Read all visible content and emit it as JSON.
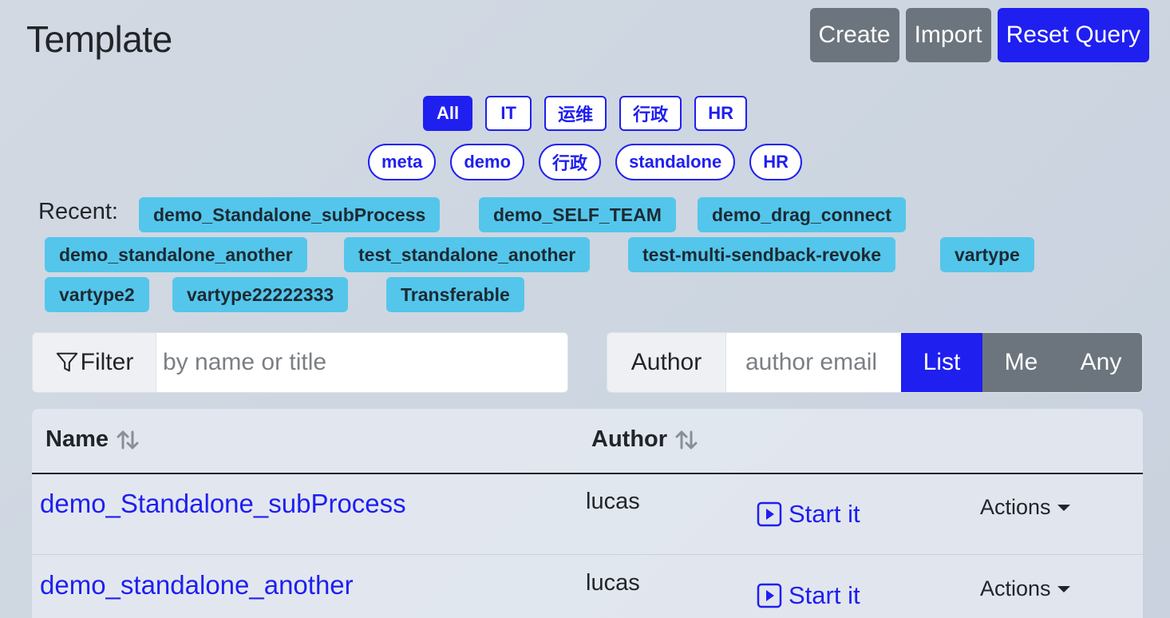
{
  "page": {
    "title": "Template"
  },
  "header_buttons": {
    "create": "Create",
    "import": "Import",
    "reset": "Reset Query"
  },
  "categories": [
    {
      "label": "All",
      "active": true
    },
    {
      "label": "IT",
      "active": false
    },
    {
      "label": "运维",
      "active": false
    },
    {
      "label": "行政",
      "active": false
    },
    {
      "label": "HR",
      "active": false
    }
  ],
  "tags": [
    "meta",
    "demo",
    "行政",
    "standalone",
    "HR"
  ],
  "recent": {
    "label": "Recent:",
    "items": [
      "demo_Standalone_subProcess",
      "demo_SELF_TEAM",
      "demo_drag_connect",
      "demo_standalone_another",
      "test_standalone_another",
      "test-multi-sendback-revoke",
      "vartype",
      "vartype2",
      "vartype22222333",
      "Transferable"
    ]
  },
  "filter": {
    "label": "Filter",
    "placeholder": "by name or title",
    "value": ""
  },
  "author_filter": {
    "label": "Author",
    "placeholder": "author email",
    "value": "",
    "options": [
      "List",
      "Me",
      "Any"
    ],
    "selected": "List"
  },
  "table": {
    "columns": {
      "name": "Name",
      "author": "Author"
    },
    "rows": [
      {
        "name": "demo_Standalone_subProcess",
        "author": "lucas",
        "start": "Start it",
        "actions": "Actions"
      },
      {
        "name": "demo_standalone_another",
        "author": "lucas",
        "start": "Start it",
        "actions": "Actions"
      }
    ]
  },
  "colors": {
    "primary": "#1f1ff0",
    "secondary": "#6c757d",
    "info": "#54c6eb"
  },
  "icons": {
    "filter": "funnel-icon",
    "sort": "sort-arrows-icon",
    "start": "play-square-icon",
    "dropdown": "caret-down-icon"
  }
}
